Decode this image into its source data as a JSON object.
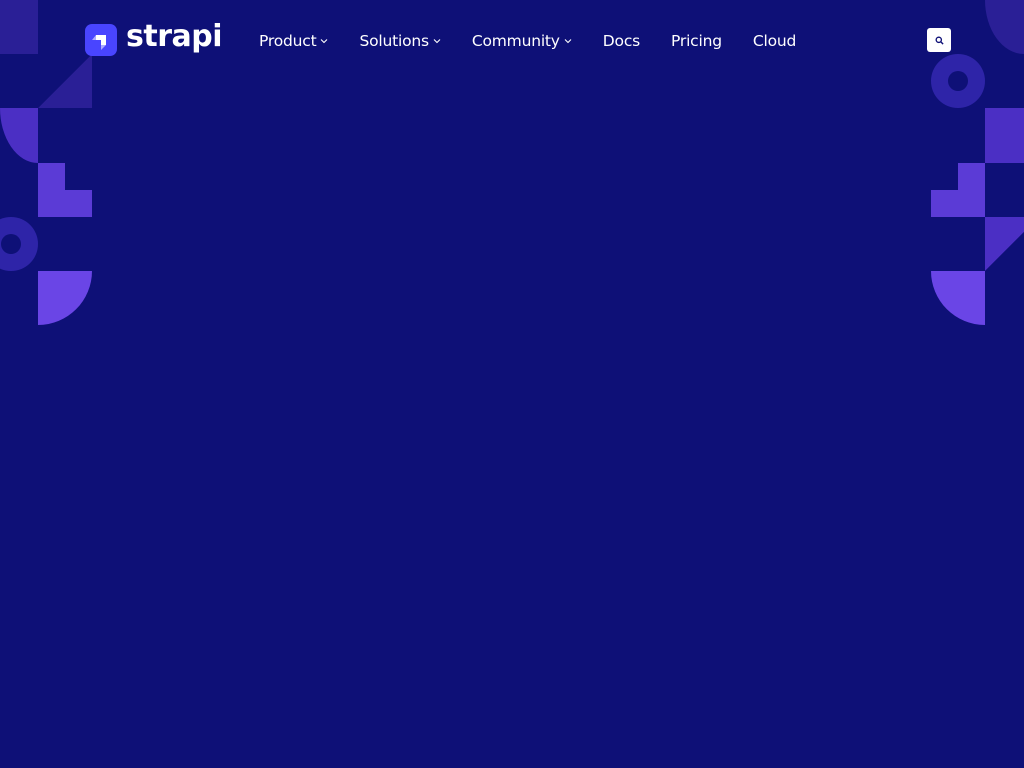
{
  "header": {
    "logo": {
      "text": "strapi",
      "icon": "strapi-logo-icon"
    },
    "nav": {
      "items": [
        {
          "label": "Product",
          "has_dropdown": true
        },
        {
          "label": "Solutions",
          "has_dropdown": true
        },
        {
          "label": "Community",
          "has_dropdown": true
        },
        {
          "label": "Docs",
          "has_dropdown": false
        },
        {
          "label": "Pricing",
          "has_dropdown": false
        },
        {
          "label": "Cloud",
          "has_dropdown": false
        }
      ]
    },
    "search": {
      "icon": "search-icon"
    }
  },
  "colors": {
    "background": "#0e1077",
    "brand": "#4945ff",
    "accent_purple": "#6c44e0",
    "text": "#ffffff"
  }
}
